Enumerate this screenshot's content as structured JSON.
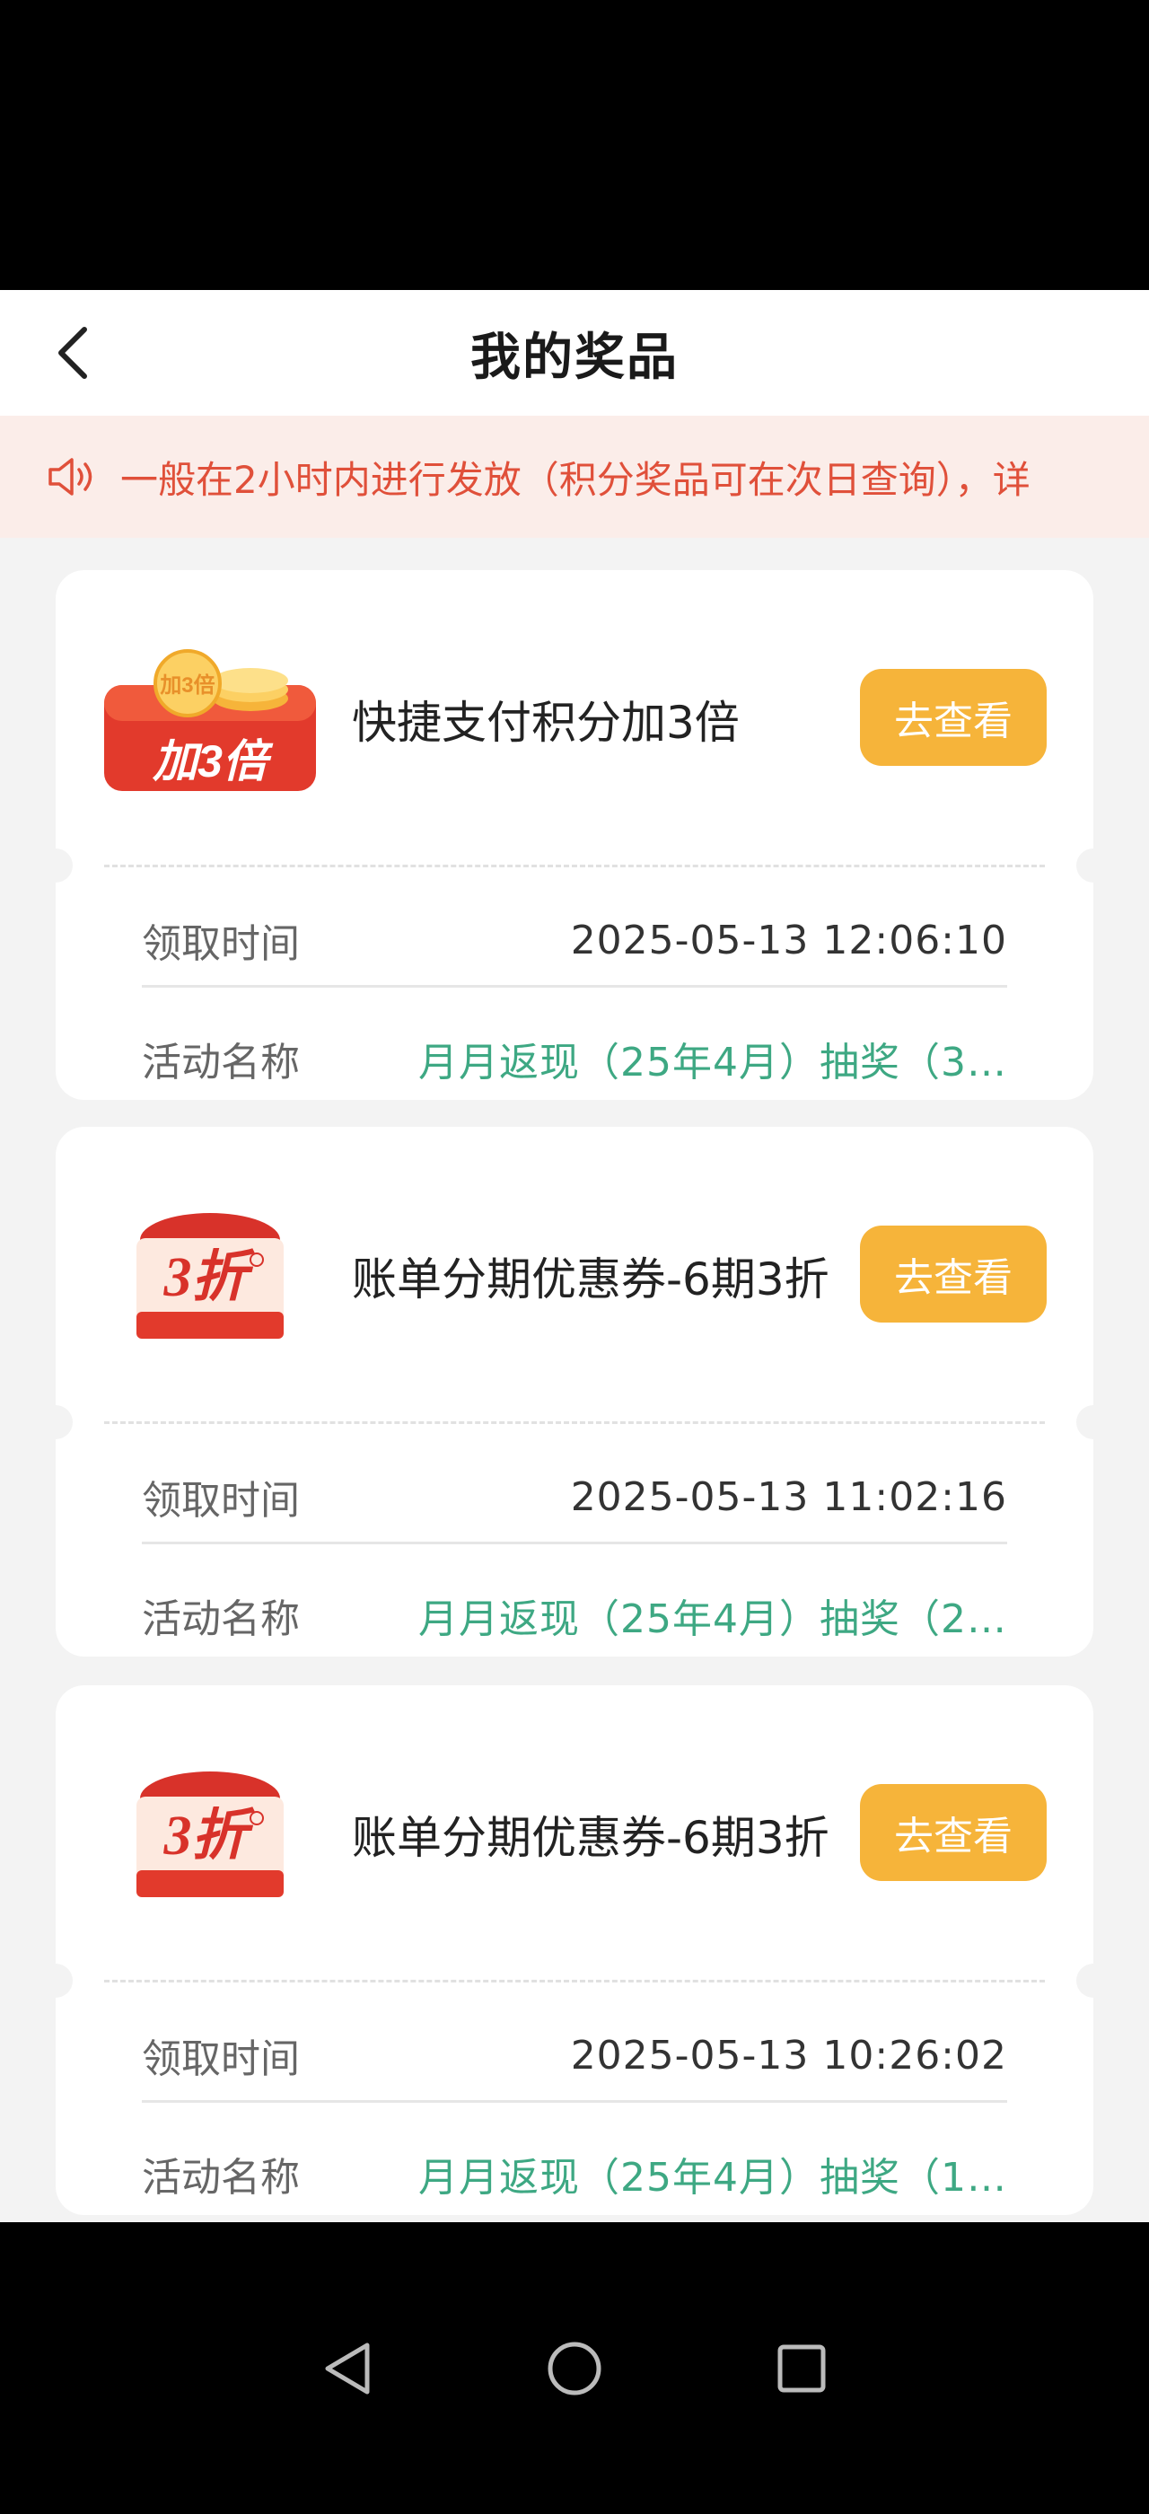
{
  "header": {
    "title": "我的奖品"
  },
  "notice": {
    "text": "一般在2小时内进行发放（积分奖品可在次日查询），详"
  },
  "prizes": [
    {
      "image_caption": "加3倍",
      "title": "快捷支付积分加3倍",
      "button": "去查看",
      "time_label": "领取时间",
      "time": "2025-05-13 12:06:10",
      "activity_label": "活动名称",
      "activity": "月月返现（25年4月）抽奖（3…"
    },
    {
      "image_caption": "3折",
      "title": "账单分期优惠券-6期3折",
      "button": "去查看",
      "time_label": "领取时间",
      "time": "2025-05-13 11:02:16",
      "activity_label": "活动名称",
      "activity": "月月返现（25年4月）抽奖（2…"
    },
    {
      "image_caption": "3折",
      "title": "账单分期优惠券-6期3折",
      "button": "去查看",
      "time_label": "领取时间",
      "time": "2025-05-13 10:26:02",
      "activity_label": "活动名称",
      "activity": "月月返现（25年4月）抽奖（1…"
    }
  ],
  "colors": {
    "accent": "#f6b43a",
    "notice": "#e0503a",
    "activity": "#3ea883"
  },
  "nav": {
    "icons": [
      "back-triangle-icon",
      "home-circle-icon",
      "recents-square-icon"
    ]
  }
}
